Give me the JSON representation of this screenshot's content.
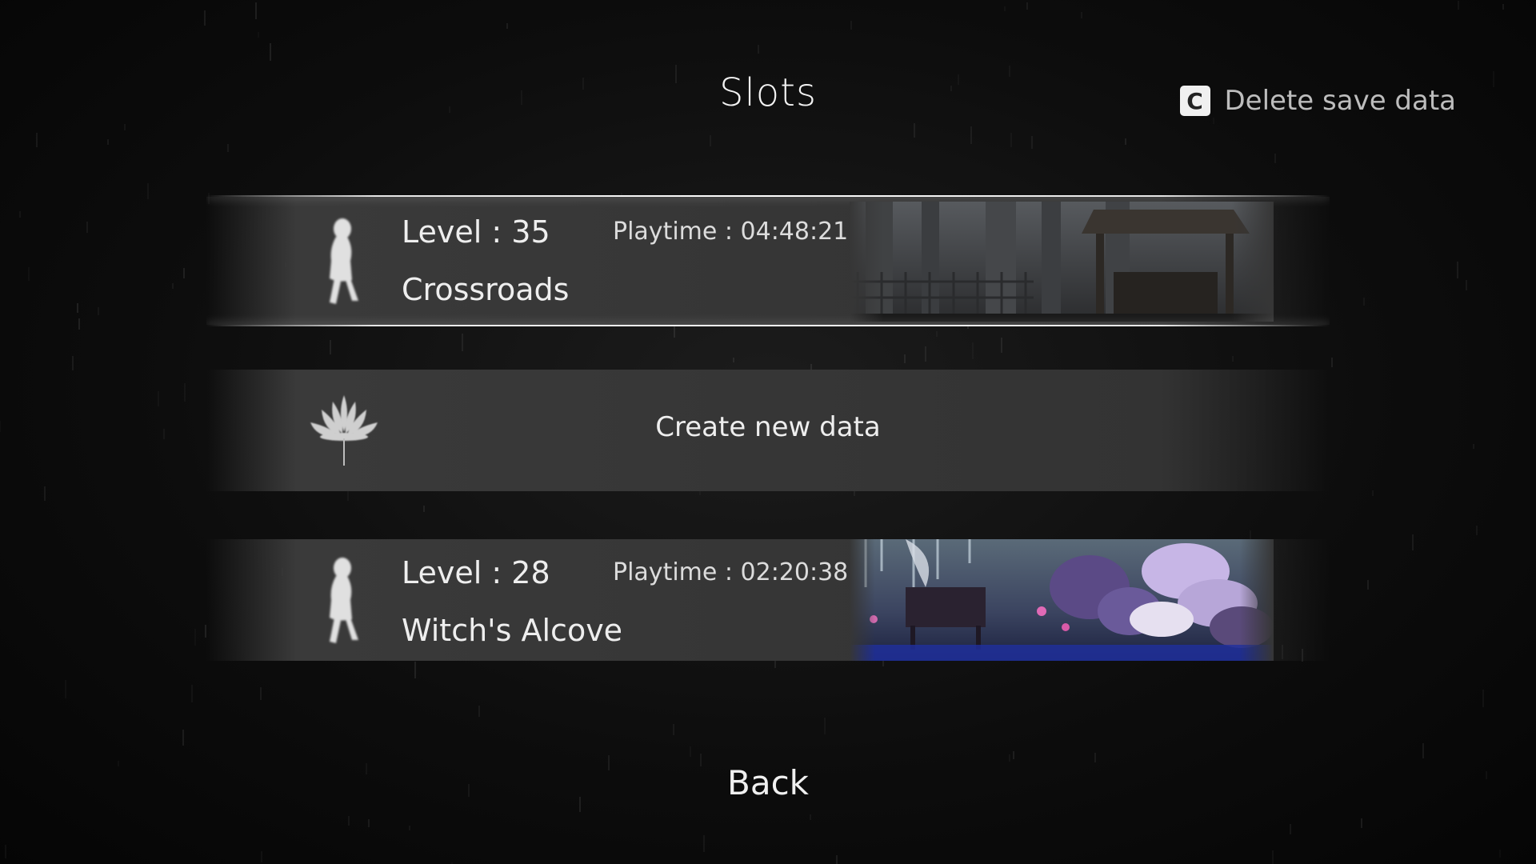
{
  "screen": {
    "title": "Slots",
    "delete_hint": {
      "key": "C",
      "label": "Delete save data"
    },
    "back_label": "Back"
  },
  "slots": [
    {
      "level": "Level : 35",
      "playtime": "Playtime : 04:48:21",
      "area": "Crossroads",
      "selected": true,
      "thumbnail": "forest-fence-gazebo-scene"
    },
    {
      "empty": true,
      "label": "Create new data",
      "icon": "lotus-icon"
    },
    {
      "level": "Level : 28",
      "playtime": "Playtime : 02:20:38",
      "area": "Witch's Alcove",
      "selected": false,
      "thumbnail": "purple-coral-bench-scene"
    }
  ],
  "colors": {
    "background": "#0d0d0d",
    "slot": "#363636",
    "highlight": "#ffffff",
    "text": "#eeeeee"
  }
}
